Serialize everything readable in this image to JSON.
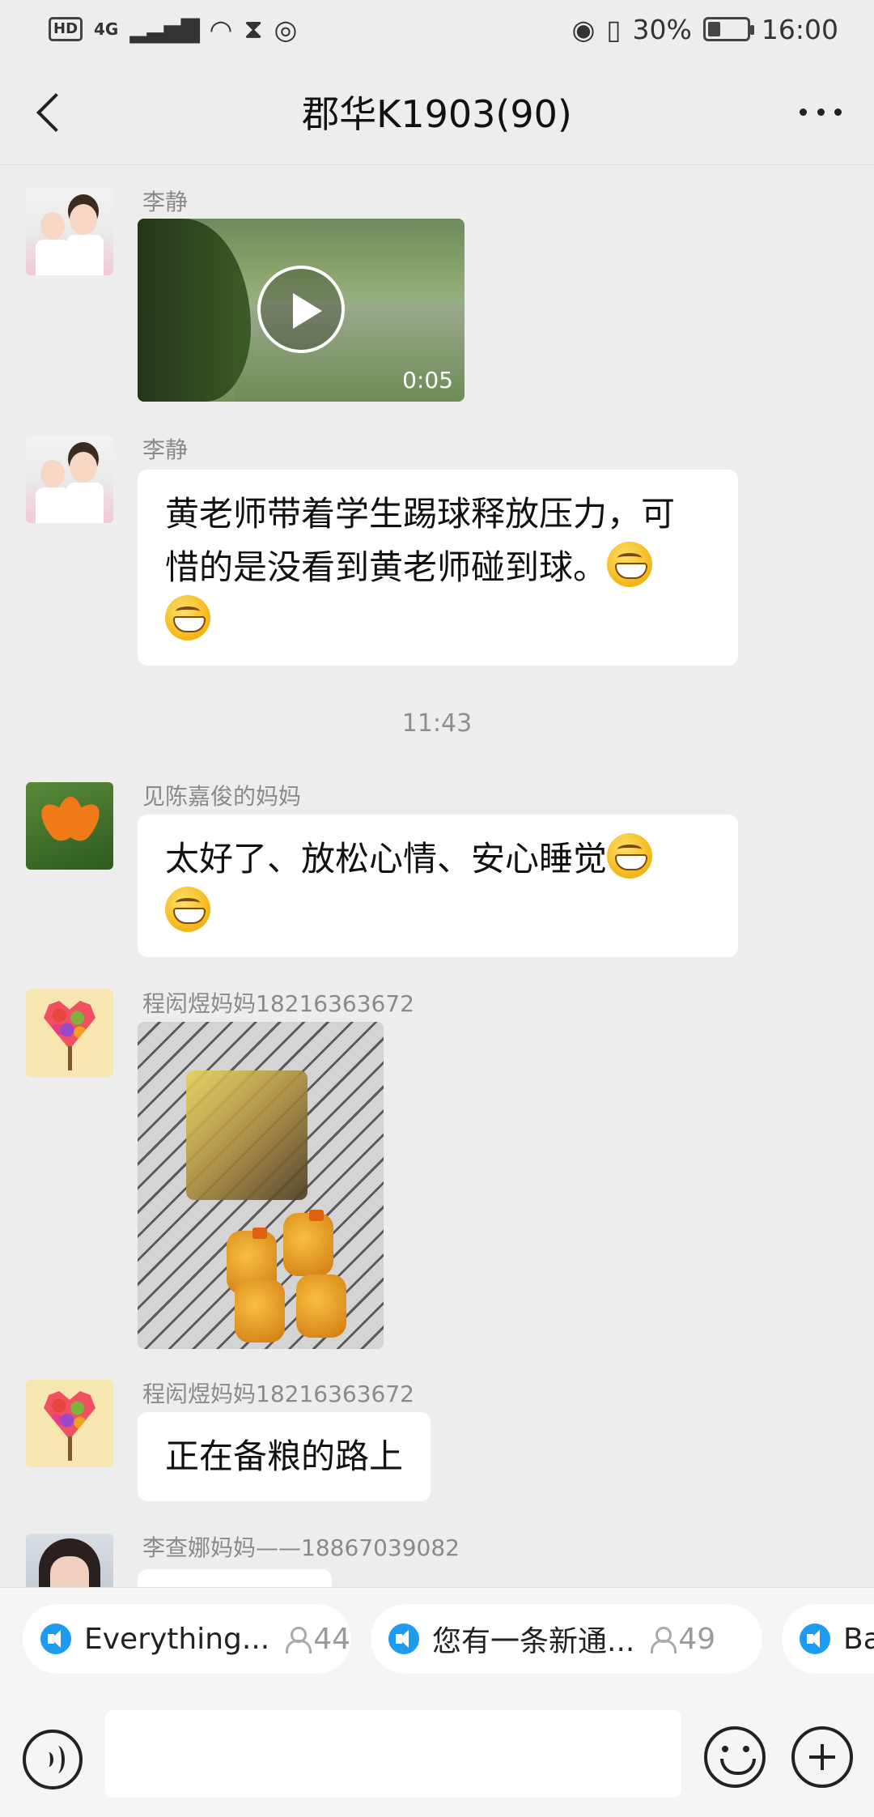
{
  "status_bar": {
    "hd": "HD",
    "network": "4G",
    "signal_icon": "signal-bars",
    "battery_pct": "30%",
    "battery_level": 0.3,
    "time": "16:00"
  },
  "header": {
    "title": "郡华K1903(90)"
  },
  "messages": [
    {
      "type": "video",
      "sender": "李静",
      "duration": "0:05",
      "avatar": "kids"
    },
    {
      "type": "text",
      "sender": "李静",
      "text_line1": "黄老师带着学生踢球释放压力，可",
      "text_line2": "惜的是没看到黄老师碰到球。",
      "avatar": "kids"
    },
    {
      "type": "time",
      "text": "11:43"
    },
    {
      "type": "text",
      "sender": "见陈嘉俊的妈妈",
      "text_line1": "太好了、放松心情、安心睡觉",
      "avatar": "flower"
    },
    {
      "type": "image",
      "sender": "程闳煜妈妈18216363672",
      "avatar": "heart-tree"
    },
    {
      "type": "text",
      "sender": "程闳煜妈妈18216363672",
      "text_line1": "正在备粮的路上",
      "avatar": "heart-tree"
    },
    {
      "type": "text",
      "sender": "李查娜妈妈——18867039082",
      "avatar": "girl"
    }
  ],
  "notices": [
    {
      "label": "Everything...",
      "count": "44"
    },
    {
      "label": "您有一条新通...",
      "count": "49"
    },
    {
      "label": "Ba",
      "count": ""
    }
  ],
  "input": {
    "placeholder": ""
  },
  "colors": {
    "background": "#ededed",
    "bubble": "#ffffff",
    "accent": "#1d9bf0"
  }
}
